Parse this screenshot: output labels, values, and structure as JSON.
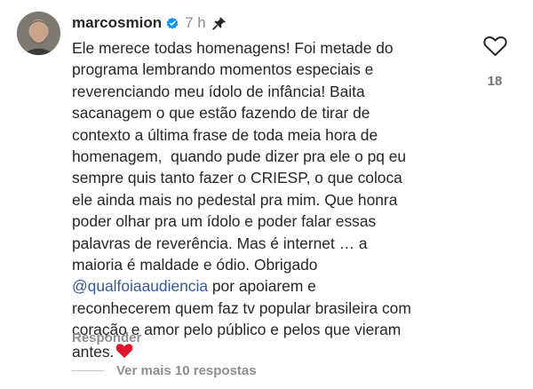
{
  "comment": {
    "username": "marcosmion",
    "time": "7 h",
    "verified": true,
    "pinned": true,
    "lines": [
      "Ele merece todas homenagens! Foi metade do",
      "programa lembrando momentos especiais e",
      "reverenciando meu ídolo de infância! Baita",
      "sacanagem o que estão fazendo de tirar de",
      "contexto a última frase de toda meia hora de",
      "homenagem,  quando pude dizer pra ele o pq eu",
      "sempre quis tanto fazer o CRIESP, o que coloca",
      "ele ainda mais no pedestal pra mim. Que honra",
      "poder olhar pra um ídolo e poder falar essas",
      "palavras de reverência. Mas é internet … a",
      "maioria é maldade e ódio. Obrigado"
    ],
    "mention": "@qualfoiaaudiencia",
    "mention_rest": " por apoiarem e",
    "lines_after": [
      "reconhecerem quem faz tv popular brasileira com",
      "coração e amor pelo público e pelos que vieram"
    ],
    "last_line": "antes.",
    "like_count": "18",
    "reply_label": "Responder",
    "more_replies_label": "Ver mais 10 respostas"
  },
  "icons": {
    "verified": "verified-badge-icon",
    "pin": "pin-icon",
    "like": "heart-outline-icon",
    "emoji": "red-heart-emoji"
  },
  "colors": {
    "verified_blue": "#0095f6",
    "mention": "#385898",
    "muted": "#8e8e8e",
    "emoji_red": "#e0162b"
  }
}
